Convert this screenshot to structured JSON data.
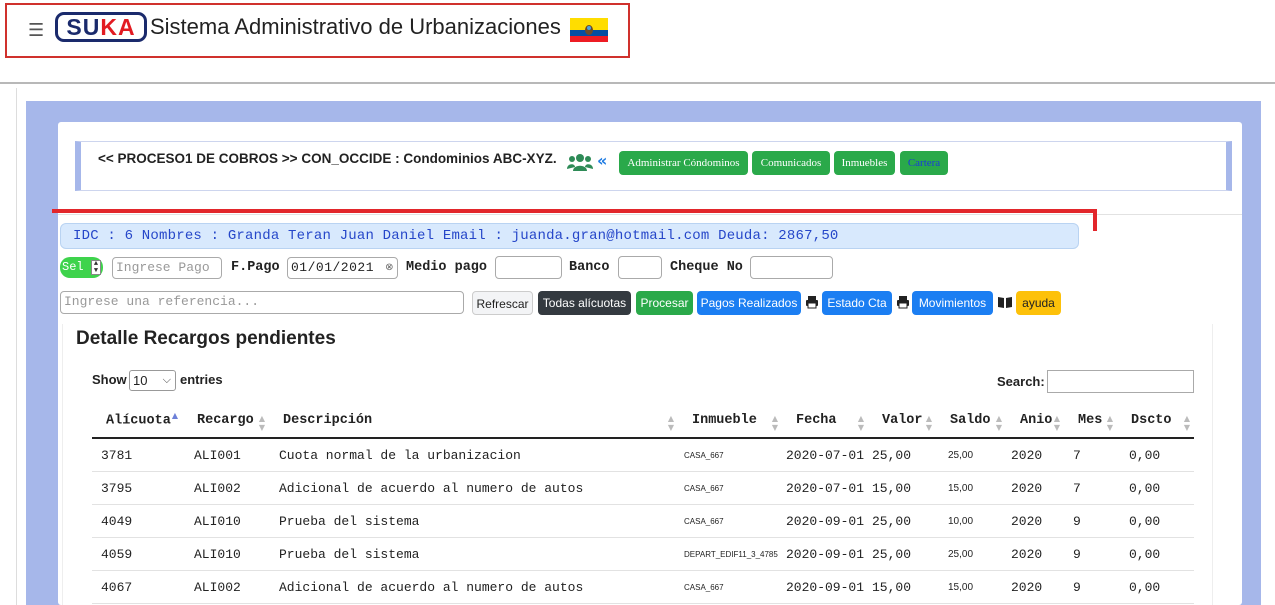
{
  "header": {
    "menu_icon": "hamburger-icon",
    "logo_s": "SUKA",
    "title": "Sistema Administrativo de Urbanizaciones",
    "flag_icon": "ecuador-flag-icon",
    "flag_colors": [
      "#ffdd00",
      "#034ea2",
      "#ed1c24"
    ]
  },
  "proceso": {
    "title": "<< PROCESO1 DE COBROS >> CON_OCCIDE : Condominios ABC-XYZ.",
    "users_icon": "users-icon",
    "back_icon": "double-chevron-left-icon",
    "buttons": [
      "Administrar Cóndominos",
      "Comunicados",
      "Inmuebles",
      "Cartera"
    ]
  },
  "info": {
    "text": "IDC : 6 Nombres : Granda Teran Juan Daniel Email : juanda.gran@hotmail.com Deuda: 2867,50"
  },
  "form": {
    "sel_label": "Sel",
    "pago_placeholder": "Ingrese Pago",
    "fpago_label": "F.Pago",
    "fpago_value": "01/01/2021",
    "medio_label": "Medio pago",
    "banco_label": "Banco",
    "cheque_label": "Cheque No",
    "ref_placeholder": "Ingrese una referencia..."
  },
  "actions": {
    "refrescar": "Refrescar",
    "todas": "Todas alícuotas",
    "procesar": "Procesar",
    "pagos": "Pagos Realizados",
    "estado": "Estado Cta",
    "movimientos": "Movimientos",
    "ayuda": "ayuda",
    "colors": {
      "green": "#2aa94a",
      "blue": "#1b7ef2",
      "dark": "#343a40",
      "yellow": "#fdc10a"
    }
  },
  "detail": {
    "title": "Detalle Recargos pendientes",
    "show_label": "Show",
    "entries_value": "10",
    "entries_label": "entries",
    "search_label": "Search:",
    "columns": [
      "Alícuota",
      "Recargo",
      "Descripción",
      "Inmueble",
      "Fecha",
      "Valor",
      "Saldo",
      "Anio",
      "Mes",
      "Dscto"
    ],
    "rows": [
      [
        "3781",
        "ALI001",
        "Cuota normal de la urbanizacion",
        "CASA_667",
        "2020-07-01",
        "25,00",
        "25,00",
        "2020",
        "7",
        "0,00"
      ],
      [
        "3795",
        "ALI002",
        "Adicional de acuerdo al numero de autos",
        "CASA_667",
        "2020-07-01",
        "15,00",
        "15,00",
        "2020",
        "7",
        "0,00"
      ],
      [
        "4049",
        "ALI010",
        "Prueba del sistema",
        "CASA_667",
        "2020-09-01",
        "25,00",
        "10,00",
        "2020",
        "9",
        "0,00"
      ],
      [
        "4059",
        "ALI010",
        "Prueba del sistema",
        "DEPART_EDIF11_3_4785",
        "2020-09-01",
        "25,00",
        "25,00",
        "2020",
        "9",
        "0,00"
      ],
      [
        "4067",
        "ALI002",
        "Adicional de acuerdo al numero de autos",
        "CASA_667",
        "2020-09-01",
        "15,00",
        "15,00",
        "2020",
        "9",
        "0,00"
      ]
    ]
  }
}
